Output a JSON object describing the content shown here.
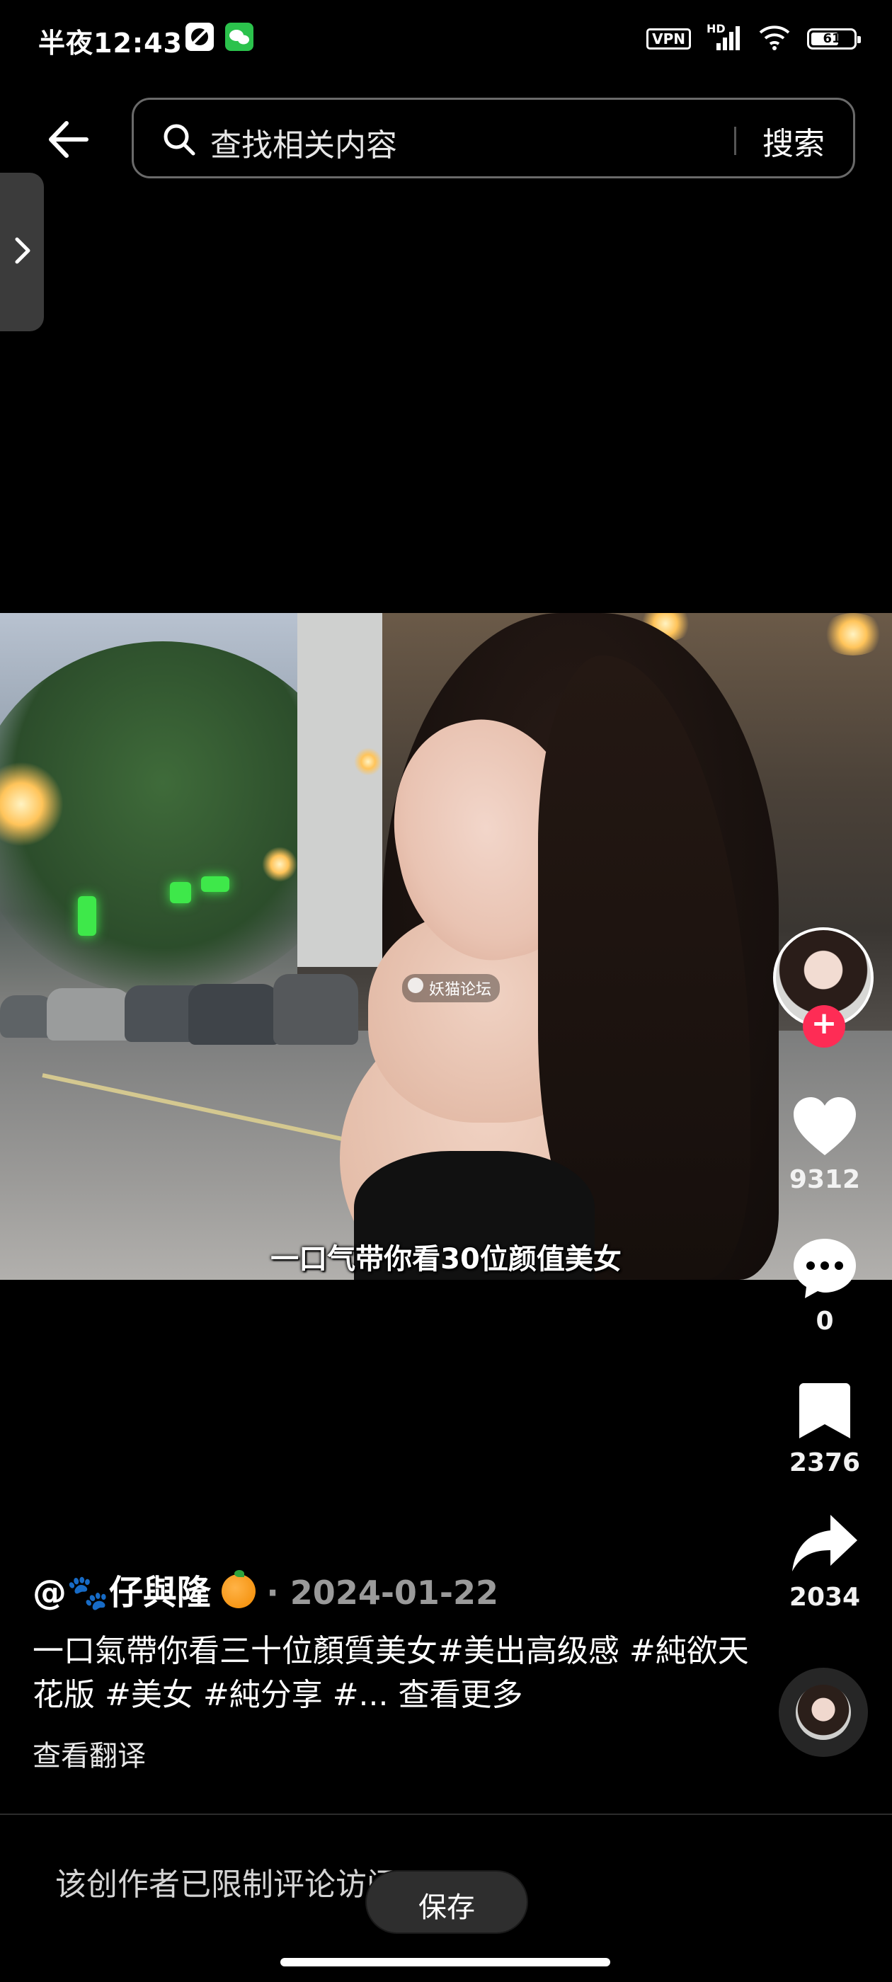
{
  "status_bar": {
    "time": "半夜12:43",
    "vpn_label": "VPN",
    "network_label": "HD",
    "battery_level": "61",
    "icons": [
      "no-disturb-icon",
      "wechat-icon",
      "vpn-icon",
      "signal-icon",
      "wifi-icon",
      "battery-icon"
    ]
  },
  "search": {
    "placeholder": "查找相关内容",
    "button_label": "搜索"
  },
  "video": {
    "caption": "一口气带你看30位颜值美女",
    "watermark": "妖猫论坛"
  },
  "actions": {
    "likes": "9312",
    "comments": "0",
    "favorites": "2376",
    "shares": "2034",
    "follow_symbol": "+"
  },
  "post": {
    "author": "@🐾仔與隆",
    "date": "· 2024-01-22",
    "description": "一口氣帶你看三十位顏質美女#美出高级感 #純欲天花版 #美女 #純分享 #...",
    "see_more": "查看更多",
    "translate": "查看翻译"
  },
  "comments": {
    "notice": "该创作者已限制评论访问"
  },
  "toast": {
    "save_label": "保存"
  },
  "colors": {
    "background": "#000000",
    "follow_accent": "#fe2c55",
    "search_border": "#6a6a6a"
  }
}
